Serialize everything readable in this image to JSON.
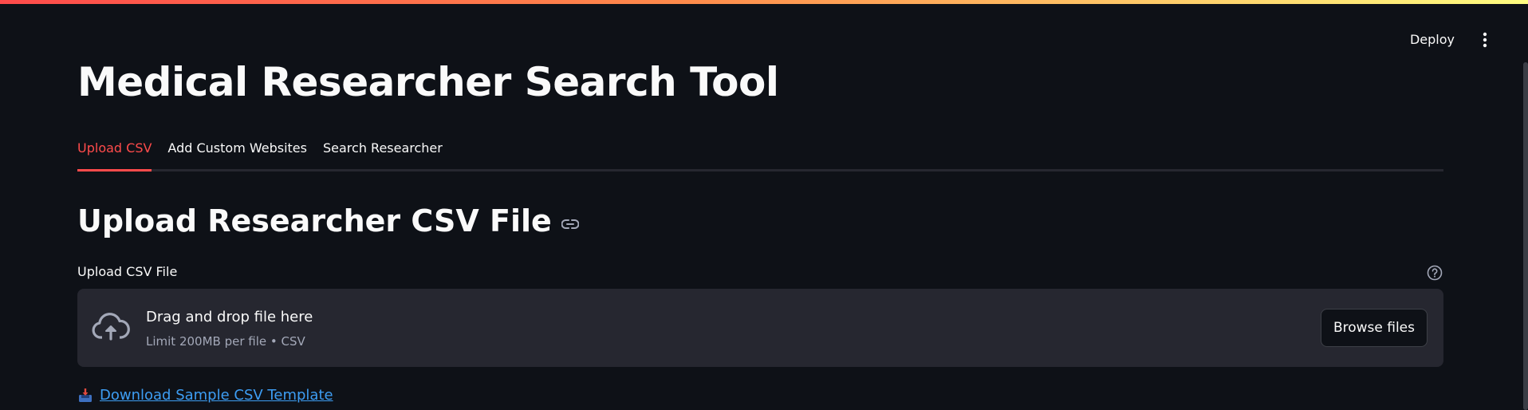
{
  "header": {
    "deploy_label": "Deploy",
    "menu_icon": "vertical-dots-icon"
  },
  "page": {
    "title": "Medical Researcher Search Tool"
  },
  "tabs": [
    {
      "label": "Upload CSV",
      "active": true
    },
    {
      "label": "Add Custom Websites",
      "active": false
    },
    {
      "label": "Search Researcher",
      "active": false
    }
  ],
  "section": {
    "title": "Upload Researcher CSV File",
    "anchor_icon": "link-icon"
  },
  "uploader": {
    "label": "Upload CSV File",
    "help_icon": "question-circle-icon",
    "dropzone_title": "Drag and drop file here",
    "dropzone_subtitle": "Limit 200MB per file • CSV",
    "browse_label": "Browse files",
    "upload_icon": "cloud-upload-icon"
  },
  "download": {
    "icon": "inbox-tray-icon",
    "label": "Download Sample CSV Template"
  },
  "colors": {
    "background": "#0e1117",
    "accent": "#ff4b4b",
    "link": "#3d9df3",
    "dropzone": "#262730"
  }
}
